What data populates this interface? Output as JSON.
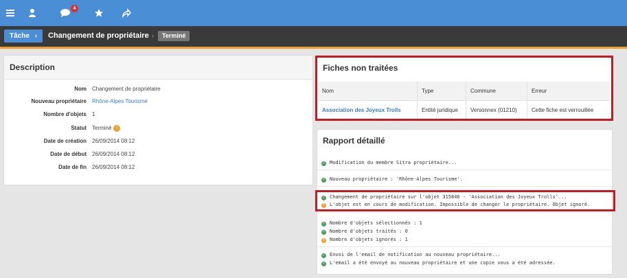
{
  "topbar": {
    "icons": [
      "menu-icon",
      "user-icon",
      "chat-icon",
      "star-icon",
      "share-icon"
    ],
    "notification_count": "4"
  },
  "breadcrumb": {
    "task": "Tâche",
    "title": "Changement de propriétaire",
    "status": "Terminé"
  },
  "description": {
    "heading": "Description",
    "rows": [
      {
        "key": "Nom",
        "value": "Changement de propriétaire"
      },
      {
        "key": "Nouveau propriétaire",
        "value": "Rhône-Alpes Tourisme"
      },
      {
        "key": "Nombre d'objets",
        "value": "1"
      },
      {
        "key": "Statut",
        "value": "Terminé"
      },
      {
        "key": "Date de création",
        "value": "26/09/2014 08:12"
      },
      {
        "key": "Date de début",
        "value": "26/09/2014 08:12"
      },
      {
        "key": "Date de fin",
        "value": "26/09/2014 08:12"
      }
    ]
  },
  "fiches": {
    "heading": "Fiches non traitées",
    "columns": [
      "Nom",
      "Type",
      "Commune",
      "Erreur"
    ],
    "rows": [
      [
        "Association des Joyeux Trolls",
        "Entité juridique",
        "Versonnex (01210)",
        "Cette fiche est verrouillée"
      ]
    ]
  },
  "report": {
    "heading": "Rapport détaillé",
    "lines": [
      {
        "status": "ok",
        "text": "Modification du membre Sitra propriétaire..."
      },
      {
        "status": "ok",
        "text": "Nouveau propriétaire : 'Rhône-Alpes Tourisme'."
      },
      {
        "status": "ok",
        "text": "Changement de propriétaire sur l'objet 315846 - 'Association des Joyeux Trolls'..."
      },
      {
        "status": "warn",
        "text": "L'objet est en cours de modification. Impossible de changer le propriétaire. Objet ignoré."
      },
      {
        "status": "ok",
        "text": "Nombre d'objets sélectionnés : 1"
      },
      {
        "status": "ok",
        "text": "Nombre d'objets traités : 0"
      },
      {
        "status": "warn",
        "text": "Nombre d'objets ignorés : 1"
      },
      {
        "status": "ok",
        "text": "Envoi de l'email de notification au nouveau propriétaire..."
      },
      {
        "status": "ok",
        "text": "L'email a été envoyé au nouveau propriétaire et une copie vous a été adressée."
      }
    ]
  },
  "colors": {
    "accent": "#4a8fd6",
    "highlight": "#c41a22",
    "ok": "#4a9e5c",
    "warn": "#f0a030"
  }
}
